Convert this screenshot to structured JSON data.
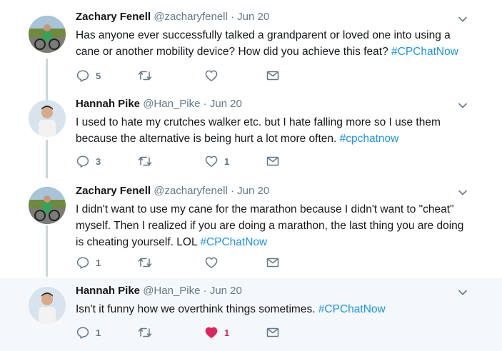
{
  "tweets": [
    {
      "name": "Zachary Fenell",
      "handle": "@zacharyfenell",
      "separator": "·",
      "date": "Jun 20",
      "line1": "Has anyone ever successfully talked a grandparent or loved one into using a",
      "line2a": "cane or another mobility device? How did you achieve this feat? ",
      "tag": "#CPChatNow",
      "replies": "5",
      "retweets": "",
      "likes": "",
      "liked": false
    },
    {
      "name": "Hannah Pike",
      "handle": "@Han_Pike",
      "separator": "·",
      "date": "Jun 20",
      "line1": "I used to hate my crutches walker etc. but I hate falling more so I use them",
      "line2a": "because the alternative is being hurt a lot more often. ",
      "tag": "#cpchatnow",
      "replies": "3",
      "retweets": "",
      "likes": "1",
      "liked": false
    },
    {
      "name": "Zachary Fenell",
      "handle": "@zacharyfenell",
      "separator": "·",
      "date": "Jun 20",
      "line1": "I didn't want to use my cane for the marathon because I didn't want to \"cheat\"",
      "line2": "myself. Then I realized if you are doing a marathon, the last thing you are doing",
      "line3a": "is cheating yourself. LOL ",
      "tag": "#CPChatNow",
      "replies": "1",
      "retweets": "",
      "likes": "",
      "liked": false
    },
    {
      "name": "Hannah Pike",
      "handle": "@Han_Pike",
      "separator": "·",
      "date": "Jun 20",
      "line1a": "Isn't it funny how we overthink things sometimes. ",
      "tag": "#CPChatNow",
      "replies": "1",
      "retweets": "",
      "likes": "1",
      "liked": true
    }
  ],
  "colors": {
    "accent": "#1b95e0",
    "like": "#e0245e",
    "muted": "#657786",
    "thread": "#ccd6dd",
    "highlight": "#f5f8fa"
  },
  "icons": {
    "reply": "reply-icon",
    "retweet": "retweet-icon",
    "like": "heart-icon",
    "dm": "envelope-icon",
    "menu": "chevron-down-icon"
  }
}
